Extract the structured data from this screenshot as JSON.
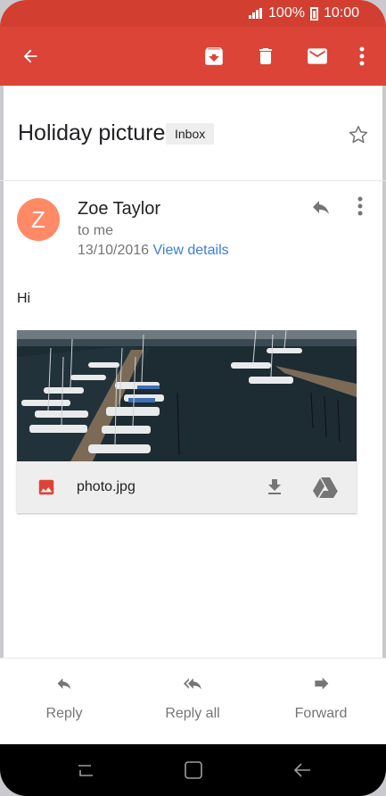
{
  "status": {
    "battery": "100%",
    "time": "10:00"
  },
  "toolbar": {
    "icons": [
      "back-arrow-icon",
      "archive-icon",
      "delete-icon",
      "mark-unread-icon",
      "more-vert-icon"
    ],
    "color": "#db4437"
  },
  "email": {
    "subject": "Holiday picture",
    "label": "Inbox",
    "sender_initial": "Z",
    "sender": "Zoe Taylor",
    "to": "to me",
    "date": "13/10/2016",
    "view_details": "View details",
    "body": "Hi"
  },
  "attachment": {
    "filename": "photo.jpg"
  },
  "actions": {
    "reply": "Reply",
    "reply_all": "Reply all",
    "forward": "Forward"
  },
  "colors": {
    "accent": "#db4437",
    "link": "#3a7de0",
    "avatar": "#ff8a65"
  }
}
